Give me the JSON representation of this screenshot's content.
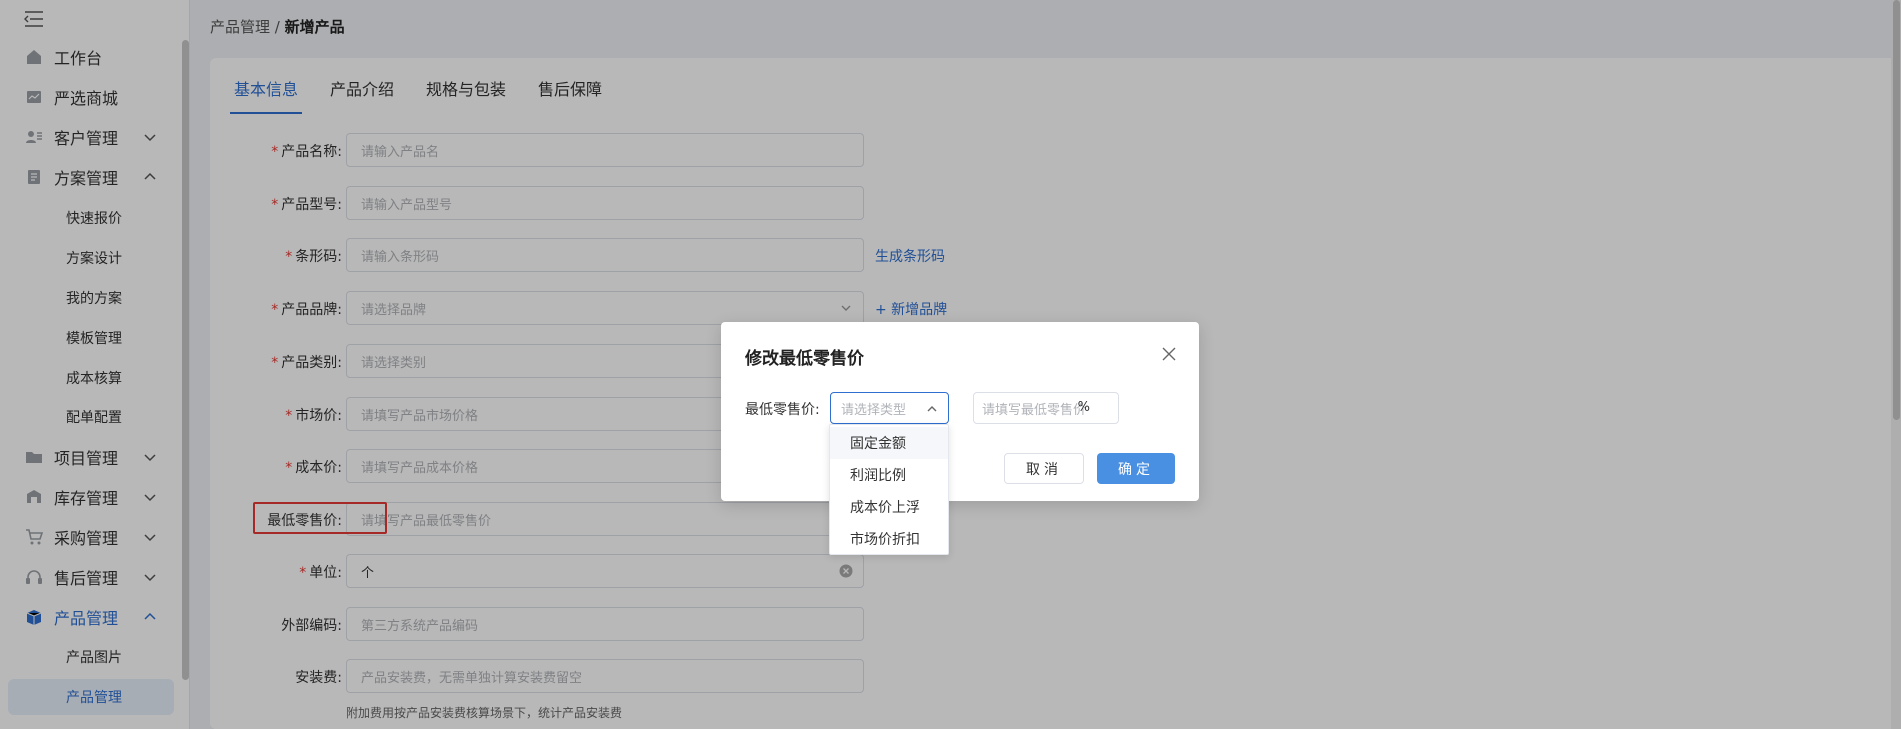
{
  "sidebar": {
    "items": [
      {
        "label": "工作台",
        "icon": "home-icon"
      },
      {
        "label": "严选商城",
        "icon": "mall-icon"
      },
      {
        "label": "客户管理",
        "icon": "customer-icon",
        "chevron": "down"
      },
      {
        "label": "方案管理",
        "icon": "plan-icon",
        "chevron": "up"
      },
      {
        "label": "项目管理",
        "icon": "folder-icon",
        "chevron": "down"
      },
      {
        "label": "库存管理",
        "icon": "inventory-icon",
        "chevron": "down"
      },
      {
        "label": "采购管理",
        "icon": "cart-icon",
        "chevron": "down"
      },
      {
        "label": "售后管理",
        "icon": "headset-icon",
        "chevron": "down"
      },
      {
        "label": "产品管理",
        "icon": "box-icon",
        "chevron": "up"
      }
    ],
    "plan_subitems": [
      "快速报价",
      "方案设计",
      "我的方案",
      "模板管理",
      "成本核算",
      "配单配置"
    ],
    "product_subitems": [
      "产品图片",
      "产品管理"
    ],
    "active_color": "#2f6fd0"
  },
  "breadcrumb": {
    "parent": "产品管理",
    "sep": "/",
    "current": "新增产品"
  },
  "tabs": [
    "基本信息",
    "产品介绍",
    "规格与包装",
    "售后保障"
  ],
  "form": {
    "rows": [
      {
        "label": "产品名称:",
        "required": true,
        "placeholder": "请输入产品名"
      },
      {
        "label": "产品型号:",
        "required": true,
        "placeholder": "请输入产品型号"
      },
      {
        "label": "条形码:",
        "required": true,
        "placeholder": "请输入条形码",
        "link": "生成条形码"
      },
      {
        "label": "产品品牌:",
        "required": true,
        "placeholder": "请选择品牌",
        "link": "+ 新增品牌"
      },
      {
        "label": "产品类别:",
        "required": true,
        "placeholder": "请选择类别"
      },
      {
        "label": "市场价:",
        "required": true,
        "placeholder": "请填写产品市场价格"
      },
      {
        "label": "成本价:",
        "required": true,
        "placeholder": "请填写产品成本价格"
      },
      {
        "label": "最低零售价:",
        "required": false,
        "placeholder": "请填写产品最低零售价"
      },
      {
        "label": "单位:",
        "required": true,
        "value": "个"
      },
      {
        "label": "外部编码:",
        "required": false,
        "placeholder": "第三方系统产品编码"
      },
      {
        "label": "安装费:",
        "required": false,
        "placeholder": "产品安装费，无需单独计算安装费留空"
      }
    ],
    "install_hint": "附加费用按产品安装费核算场景下，统计产品安装费"
  },
  "modal": {
    "title": "修改最低零售价",
    "field_label": "最低零售价:",
    "select_placeholder": "请选择类型",
    "input_placeholder": "请填写最低零售价",
    "unit": "%",
    "cancel": "取消",
    "ok": "确定"
  },
  "dropdown": {
    "options": [
      "固定金额",
      "利润比例",
      "成本价上浮",
      "市场价折扣"
    ]
  }
}
